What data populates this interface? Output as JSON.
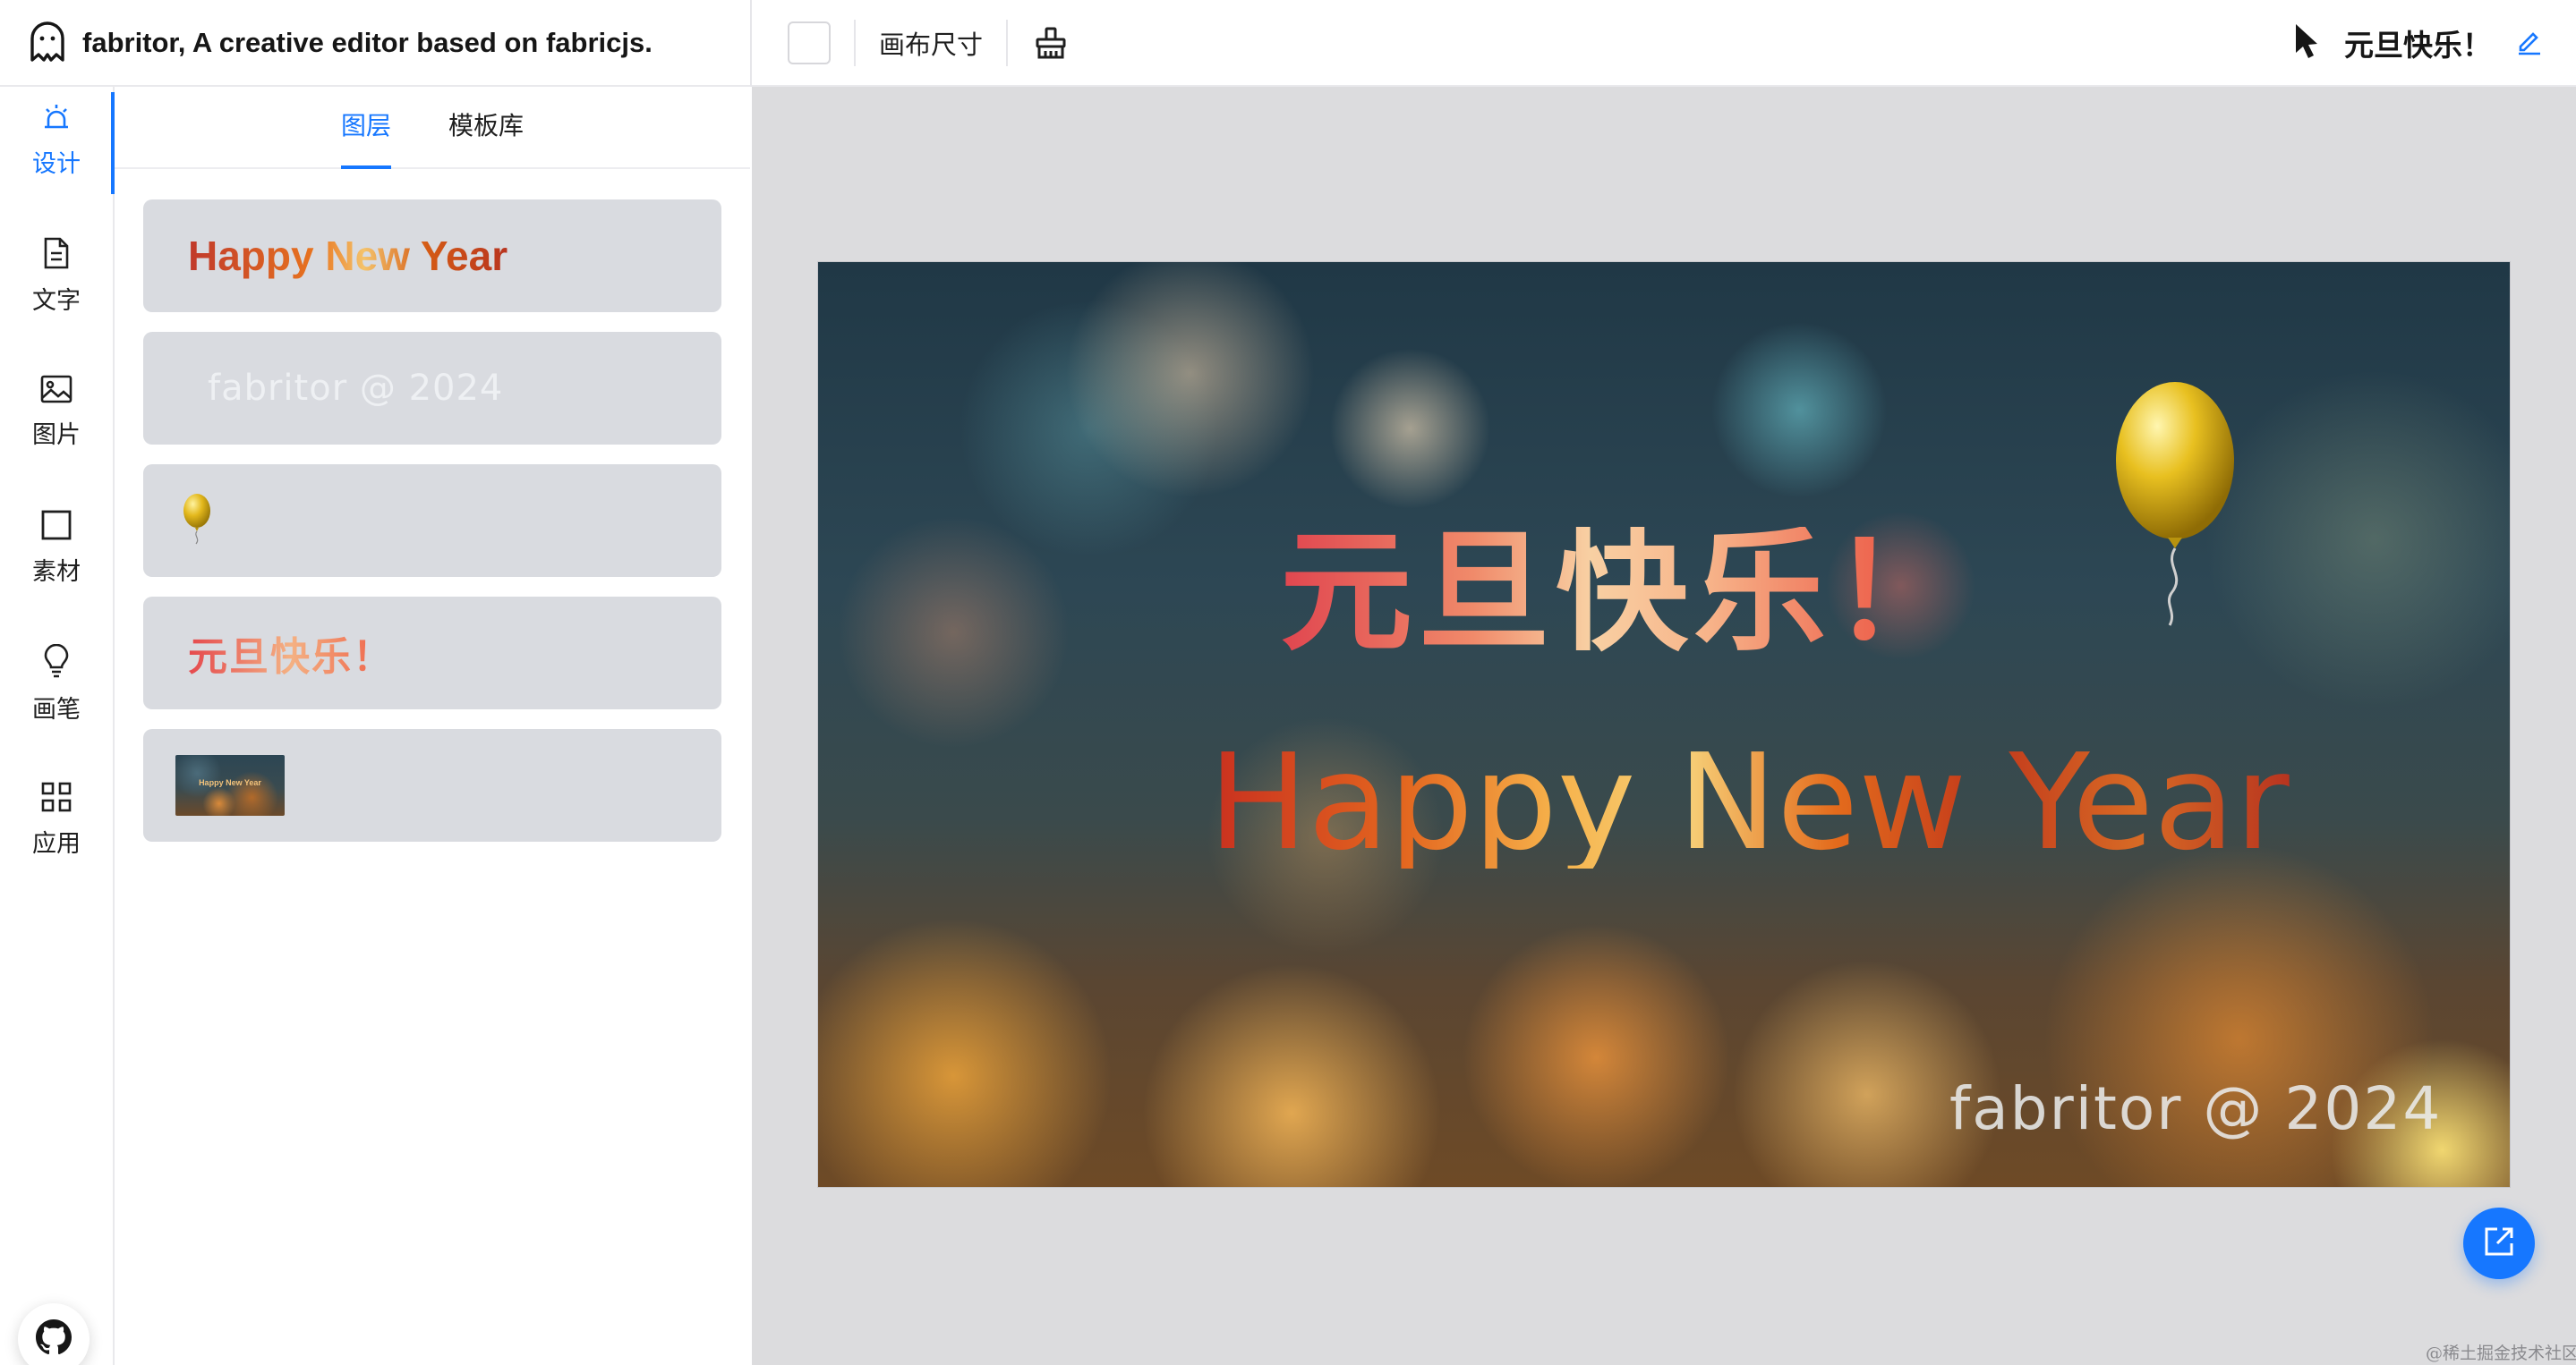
{
  "app": {
    "title": "fabritor, A creative editor based on fabricjs.",
    "logo_icon": "ghost-icon"
  },
  "toolbar": {
    "canvas_size_label": "画布尺寸",
    "clear_icon": "clear-brush-icon",
    "background_color": "#ffffff"
  },
  "header_right": {
    "select_icon": "cursor-arrow-icon",
    "document_title": "元旦快乐！",
    "edit_icon": "pencil-edit-icon"
  },
  "rail": {
    "items": [
      {
        "label": "设计",
        "icon": "design-bell-icon",
        "active": true
      },
      {
        "label": "文字",
        "icon": "document-text-icon",
        "active": false
      },
      {
        "label": "图片",
        "icon": "image-icon",
        "active": false
      },
      {
        "label": "素材",
        "icon": "square-shape-icon",
        "active": false
      },
      {
        "label": "画笔",
        "icon": "lightbulb-brush-icon",
        "active": false
      },
      {
        "label": "应用",
        "icon": "apps-grid-icon",
        "active": false
      }
    ],
    "github_icon": "github-icon"
  },
  "panel": {
    "tabs": [
      {
        "label": "图层",
        "active": true
      },
      {
        "label": "模板库",
        "active": false
      }
    ],
    "layers": [
      {
        "type": "text",
        "text": "Happy New Year"
      },
      {
        "type": "text",
        "text": "fabritor @ 2024"
      },
      {
        "type": "image",
        "icon": "balloon-icon"
      },
      {
        "type": "text",
        "text": "元旦快乐！"
      },
      {
        "type": "image",
        "thumb_text": "Happy New Year"
      }
    ]
  },
  "canvas": {
    "title_cn": "元旦快乐！",
    "title_en": "Happy New Year",
    "signature": "fabritor @ 2024",
    "balloon_icon": "balloon-icon"
  },
  "export_icon": "export-share-icon",
  "watermark": "@稀土掘金技术社区",
  "colors": {
    "accent": "#1677ff",
    "workspace_bg": "#dcdcde",
    "layer_bg": "#d9dbe0"
  }
}
